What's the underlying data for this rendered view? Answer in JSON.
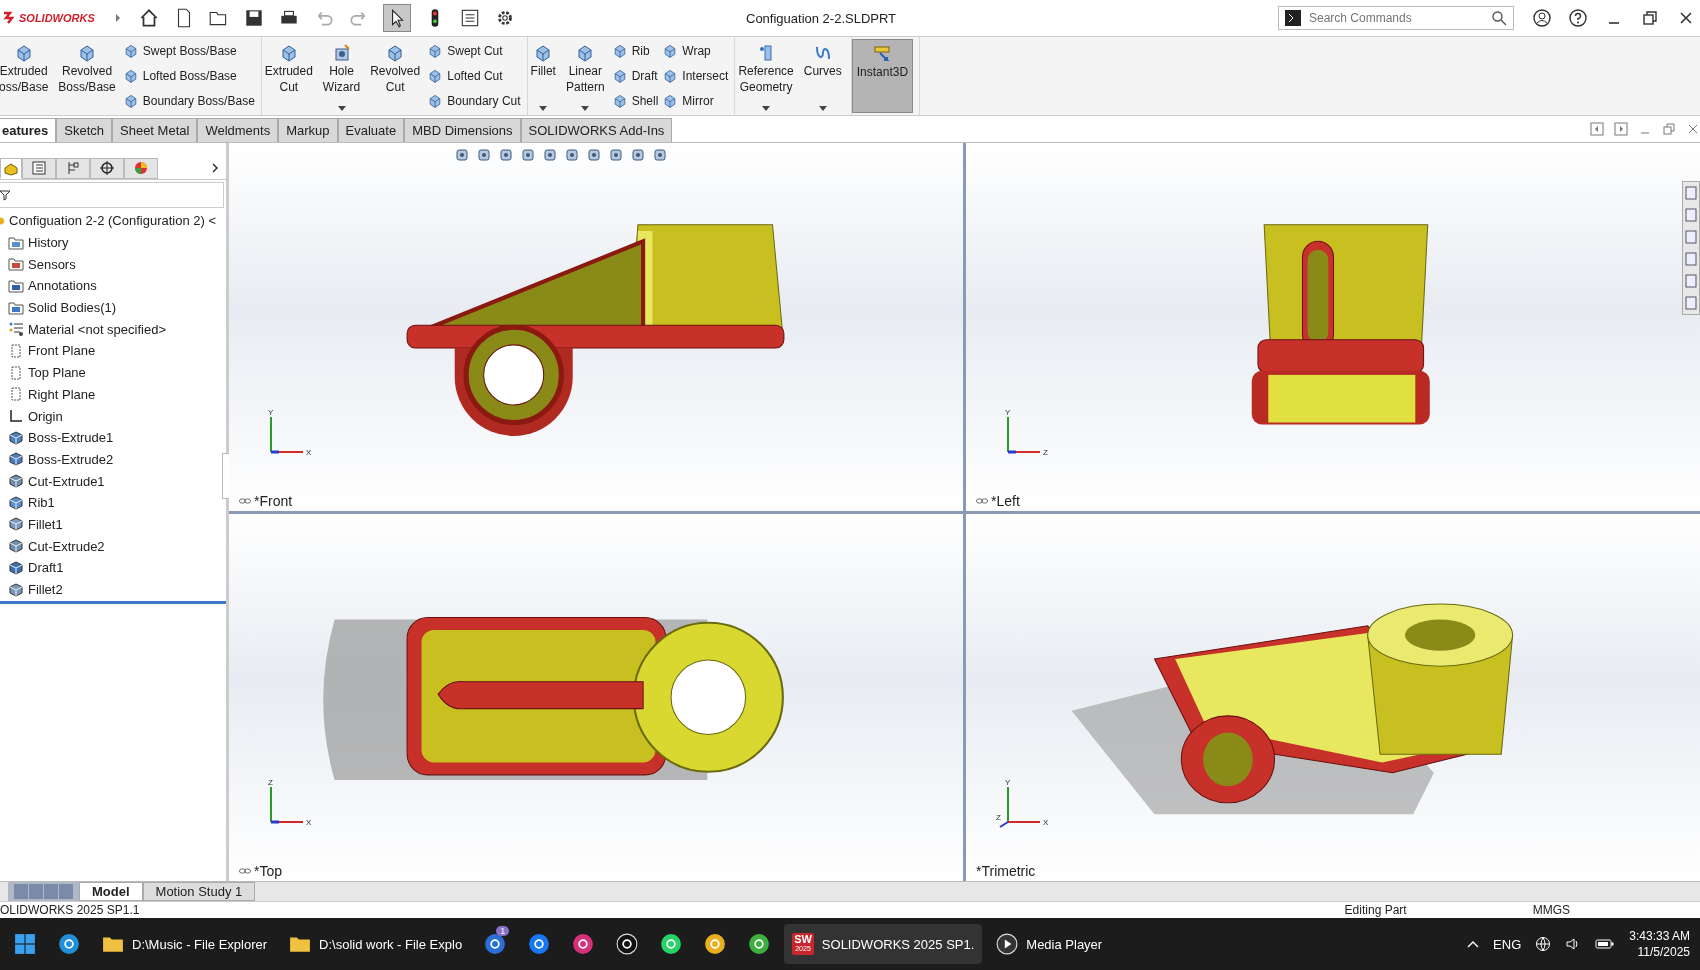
{
  "app": {
    "logo": "SOLIDWORKS",
    "title": "Configuation 2-2.SLDPRT",
    "search": {
      "placeholder": "Search Commands"
    }
  },
  "ribbon": {
    "groups": [
      {
        "items": [
          {
            "kind": "large",
            "lines": [
              "Extruded",
              "oss/Base"
            ],
            "dropdown": false,
            "pressed": false
          },
          {
            "kind": "large",
            "lines": [
              "Revolved",
              "Boss/Base"
            ],
            "dropdown": false,
            "pressed": false
          },
          {
            "kind": "stack",
            "entries": [
              {
                "label": "Swept Boss/Base"
              },
              {
                "label": "Lofted Boss/Base"
              },
              {
                "label": "Boundary Boss/Base"
              }
            ]
          }
        ]
      },
      {
        "items": [
          {
            "kind": "large",
            "lines": [
              "Extruded",
              "Cut"
            ],
            "dropdown": false,
            "pressed": false
          },
          {
            "kind": "large",
            "lines": [
              "Hole",
              "Wizard"
            ],
            "dropdown": true,
            "pressed": false
          },
          {
            "kind": "large",
            "lines": [
              "Revolved",
              "Cut"
            ],
            "dropdown": false,
            "pressed": false
          },
          {
            "kind": "stack",
            "entries": [
              {
                "label": "Swept Cut"
              },
              {
                "label": "Lofted Cut"
              },
              {
                "label": "Boundary Cut"
              }
            ]
          }
        ]
      },
      {
        "items": [
          {
            "kind": "large",
            "lines": [
              "Fillet"
            ],
            "dropdown": true,
            "pressed": false
          },
          {
            "kind": "large",
            "lines": [
              "Linear",
              "Pattern"
            ],
            "dropdown": true,
            "pressed": false
          },
          {
            "kind": "stack",
            "entries": [
              {
                "label": "Rib"
              },
              {
                "label": "Draft"
              },
              {
                "label": "Shell"
              }
            ]
          },
          {
            "kind": "stack",
            "entries": [
              {
                "label": "Wrap"
              },
              {
                "label": "Intersect"
              },
              {
                "label": "Mirror"
              }
            ]
          }
        ]
      },
      {
        "items": [
          {
            "kind": "large",
            "lines": [
              "Reference",
              "Geometry"
            ],
            "dropdown": true,
            "pressed": false
          },
          {
            "kind": "large",
            "lines": [
              "Curves"
            ],
            "dropdown": true,
            "pressed": false
          }
        ]
      },
      {
        "items": [
          {
            "kind": "large",
            "lines": [
              "Instant3D"
            ],
            "dropdown": false,
            "pressed": true
          }
        ]
      }
    ]
  },
  "command_tabs": [
    {
      "label": "eatures",
      "selected": true
    },
    {
      "label": "Sketch",
      "selected": false
    },
    {
      "label": "Sheet Metal",
      "selected": false
    },
    {
      "label": "Weldments",
      "selected": false
    },
    {
      "label": "Markup",
      "selected": false
    },
    {
      "label": "Evaluate",
      "selected": false
    },
    {
      "label": "MBD Dimensions",
      "selected": false
    },
    {
      "label": "SOLIDWORKS Add-Ins",
      "selected": false
    }
  ],
  "manager_tabs": [
    {
      "kind": "tree",
      "selected": true
    },
    {
      "kind": "property",
      "selected": false
    },
    {
      "kind": "config",
      "selected": false
    },
    {
      "kind": "dimxpert",
      "selected": false
    },
    {
      "kind": "display",
      "selected": false
    }
  ],
  "tree": {
    "label": "Configuation 2-2 (Configuration 2) <",
    "children": [
      {
        "kind": "history",
        "label": "History"
      },
      {
        "kind": "sensors",
        "label": "Sensors"
      },
      {
        "kind": "annotations",
        "label": "Annotations"
      },
      {
        "kind": "bodies",
        "label": "Solid Bodies(1)"
      },
      {
        "kind": "material",
        "label": "Material <not specified>"
      },
      {
        "kind": "plane",
        "label": "Front Plane"
      },
      {
        "kind": "plane",
        "label": "Top Plane"
      },
      {
        "kind": "plane",
        "label": "Right Plane"
      },
      {
        "kind": "origin",
        "label": "Origin"
      },
      {
        "kind": "boss",
        "label": "Boss-Extrude1"
      },
      {
        "kind": "boss",
        "label": "Boss-Extrude2"
      },
      {
        "kind": "cut",
        "label": "Cut-Extrude1"
      },
      {
        "kind": "rib",
        "label": "Rib1"
      },
      {
        "kind": "fillet",
        "label": "Fillet1"
      },
      {
        "kind": "cut",
        "label": "Cut-Extrude2"
      },
      {
        "kind": "draft",
        "label": "Draft1"
      },
      {
        "kind": "fillet",
        "label": "Fillet2"
      }
    ]
  },
  "viewports": [
    {
      "kind": "front",
      "label": "*Front",
      "axes": [
        "Y",
        "X"
      ]
    },
    {
      "kind": "left",
      "label": "*Left",
      "axes": [
        "Y",
        "Z"
      ]
    },
    {
      "kind": "top",
      "label": "*Top",
      "axes": [
        "Z",
        "X"
      ]
    },
    {
      "kind": "trimetric",
      "label": "*Trimetric",
      "axes": [
        "Y",
        "Z",
        "X"
      ]
    }
  ],
  "bottom_tabs": [
    {
      "label": "Model",
      "selected": true
    },
    {
      "label": "Motion Study 1",
      "selected": false
    }
  ],
  "status_bar": {
    "version": "OLIDWORKS 2025 SP1.1",
    "mode": "Editing Part",
    "units": "MMGS"
  },
  "taskbar": {
    "apps": [
      {
        "kind": "start"
      },
      {
        "kind": "edge"
      },
      {
        "kind": "folder",
        "label": "D:\\Music - File Explorer"
      },
      {
        "kind": "folder",
        "label": "D:\\solid work - File Explo"
      },
      {
        "kind": "store",
        "badge": "1"
      },
      {
        "kind": "facebook"
      },
      {
        "kind": "instagram"
      },
      {
        "kind": "tiktok"
      },
      {
        "kind": "whatsapp"
      },
      {
        "kind": "chrome"
      },
      {
        "kind": "upwork"
      },
      {
        "kind": "solidworks",
        "icon_text": "SW",
        "icon_sub": "2025",
        "label": "SOLIDWORKS 2025 SP1."
      },
      {
        "kind": "media",
        "label": "Media Player"
      }
    ],
    "language": "ENG",
    "time": "3:43:33 AM",
    "date": "11/5/2025"
  }
}
